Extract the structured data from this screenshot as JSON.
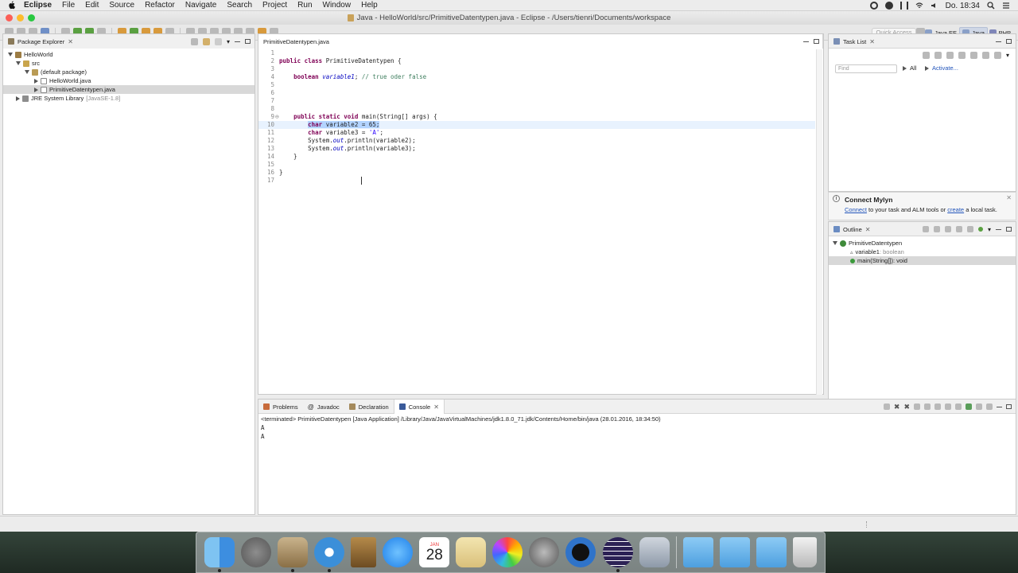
{
  "menubar": {
    "app_name": "Eclipse",
    "items": [
      "File",
      "Edit",
      "Source",
      "Refactor",
      "Navigate",
      "Search",
      "Project",
      "Run",
      "Window",
      "Help"
    ],
    "clock": "Do. 18:34"
  },
  "window": {
    "title": "Java - HelloWorld/src/PrimitiveDatentypen.java - Eclipse - /Users/tienri/Documents/workspace"
  },
  "toolbar": {
    "quick_access_placeholder": "Quick Access",
    "perspectives": [
      {
        "label": "Java EE",
        "active": false
      },
      {
        "label": "Java",
        "active": true
      },
      {
        "label": "PHP",
        "active": false
      }
    ]
  },
  "package_explorer": {
    "tab_label": "Package Explorer",
    "tree": {
      "project": "HelloWorld",
      "src": "src",
      "package": "(default package)",
      "files": [
        "HelloWorld.java",
        "PrimitiveDatentypen.java"
      ],
      "selected_file": "PrimitiveDatentypen.java",
      "jre_label": "JRE System Library",
      "jre_version": "[JavaSE-1.8]"
    }
  },
  "editor": {
    "tab_label": "PrimitiveDatentypen.java",
    "lines": [
      {
        "n": "1",
        "text": ""
      },
      {
        "n": "2",
        "text": "public class PrimitiveDatentypen {"
      },
      {
        "n": "3",
        "text": ""
      },
      {
        "n": "4",
        "text": "    boolean variable1; // true oder false"
      },
      {
        "n": "5",
        "text": ""
      },
      {
        "n": "6",
        "text": ""
      },
      {
        "n": "7",
        "text": ""
      },
      {
        "n": "8",
        "text": ""
      },
      {
        "n": "9",
        "text": "    public static void main(String[] args) {"
      },
      {
        "n": "10",
        "text": "        char variable2 = 65;"
      },
      {
        "n": "11",
        "text": "        char variable3 = 'A';"
      },
      {
        "n": "12",
        "text": "        System.out.println(variable2);"
      },
      {
        "n": "13",
        "text": "        System.out.println(variable3);"
      },
      {
        "n": "14",
        "text": "    }"
      },
      {
        "n": "15",
        "text": ""
      },
      {
        "n": "16",
        "text": "}"
      },
      {
        "n": "17",
        "text": ""
      }
    ]
  },
  "task_list": {
    "tab_label": "Task List",
    "find_placeholder": "Find",
    "filter_all": "All",
    "activate": "Activate..."
  },
  "mylyn": {
    "title": "Connect Mylyn",
    "link_connect": "Connect",
    "text_middle": " to your task and ALM tools or ",
    "link_create": "create",
    "text_end": " a local task."
  },
  "outline": {
    "tab_label": "Outline",
    "class_name": "PrimitiveDatentypen",
    "members": [
      {
        "name": "variable1",
        "type": " : boolean",
        "selected": false
      },
      {
        "name": "main(String[])",
        "type": " : void",
        "selected": true
      }
    ]
  },
  "bottom_panel": {
    "tabs": [
      "Problems",
      "Javadoc",
      "Declaration",
      "Console"
    ],
    "active_tab": "Console",
    "terminated_line": "<terminated> PrimitiveDatentypen [Java Application] /Library/Java/JavaVirtualMachines/jdk1.8.0_71.jdk/Contents/Home/bin/java (28.01.2016, 18:34:50)",
    "output": [
      "A",
      "A"
    ]
  },
  "dock": {
    "calendar_month": "JAN",
    "calendar_day": "28",
    "apps": [
      "finder-icon",
      "launchpad-icon",
      "preview-icon",
      "safari-icon",
      "notes-icon",
      "messages-icon",
      "calendar-icon",
      "preview-photos-icon",
      "photos-icon",
      "system-preferences-icon",
      "quicktime-icon",
      "eclipse-icon",
      "image-capture-icon",
      "applications-folder-icon",
      "documents-folder-icon",
      "downloads-folder-icon",
      "trash-icon"
    ]
  },
  "colors": {
    "keyword": "#7f0055",
    "string": "#2a00ff",
    "comment": "#3f7f5f",
    "field": "#0000c0",
    "selection": "#b3d4ff",
    "current_line": "#e8f2fe"
  }
}
